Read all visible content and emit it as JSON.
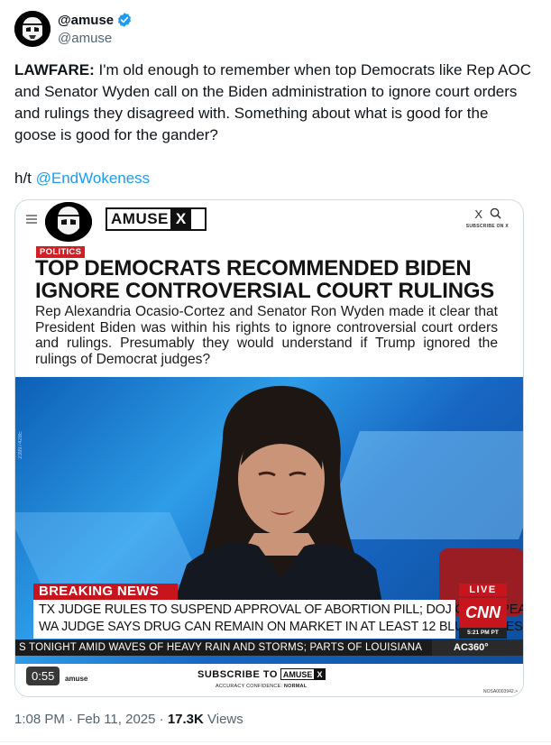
{
  "author": {
    "display_name": "@amuse",
    "handle": "@amuse"
  },
  "tweet": {
    "lead_bold": "LAWFARE:",
    "body": " I'm old enough to remember when top Democrats like Rep AOC and Senator Wyden call on the Biden administration to ignore court orders and rulings they disagreed with. Something about what is good for the goose is good for the gander?",
    "ht_prefix": "h/t ",
    "ht_link": "@EndWokeness"
  },
  "card": {
    "logo_left": "AMUSE",
    "logo_right": "X",
    "top_icons": [
      "X",
      "search-icon"
    ],
    "subscribe_small": "SUBSCRIBE ON X",
    "category": "POLITICS",
    "headline_line1": "TOP DEMOCRATS RECOMMENDED BIDEN",
    "headline_line2": "IGNORE CONTROVERSIAL COURT RULINGS",
    "summary": "Rep Alexandria Ocasio-Cortez and Senator Ron Wyden made it clear that President Biden was within his rights to ignore controversial court orders and rulings. Presumably they would understand if Trump ignored the rulings of Democrat judges?"
  },
  "video": {
    "vertical_code": "23997428E",
    "breaking_label": "BREAKING NEWS",
    "breaking_line1": "TX JUDGE RULES TO SUSPEND APPROVAL OF ABORTION PILL; DOJ CAN APPEAL;",
    "breaking_line2": "WA JUDGE SAYS DRUG CAN REMAIN ON MARKET IN AT LEAST 12 BLUE STATES",
    "live": "LIVE",
    "network": "CNN",
    "time": "5:21 PM PT",
    "ticker": "S TONIGHT AMID WAVES OF HEAVY RAIN AND STORMS; PARTS OF LOUISIANA",
    "show": "AC360°",
    "duration": "0:55"
  },
  "card_footer": {
    "amuse_label": "amuse",
    "subscribe_text": "SUBSCRIBE TO",
    "logo_left": "AMUSE",
    "logo_right": "X",
    "accuracy_prefix": "ACCURACY CONFIDENCE: ",
    "accuracy_value": "NORMAL",
    "corner_code": "NOSA0003942.>"
  },
  "meta": {
    "time": "1:08 PM · Feb 11, 2025 · ",
    "views_count": "17.3K",
    "views_label": " Views"
  },
  "colors": {
    "link": "#1d9bf0",
    "verified": "#1d9bf0",
    "cnn_red": "#c8141d",
    "muted": "#536471"
  }
}
